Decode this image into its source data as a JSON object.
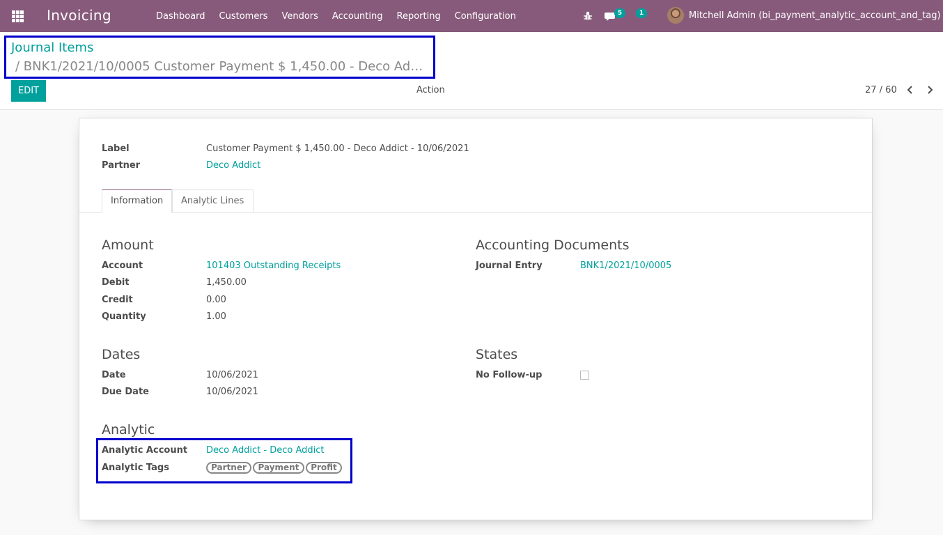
{
  "navbar": {
    "app_name": "Invoicing",
    "menu": [
      "Dashboard",
      "Customers",
      "Vendors",
      "Accounting",
      "Reporting",
      "Configuration"
    ],
    "messages_count": "5",
    "activities_count": "1",
    "user_name": "Mitchell Admin (bi_payment_analytic_account_and_tag)",
    "bg_color": "#875a7b"
  },
  "control": {
    "breadcrumb_root": "Journal Items",
    "breadcrumb_current": "/ BNK1/2021/10/0005 Customer Payment $ 1,450.00 - Deco Ad…",
    "edit_label": "EDIT",
    "action_label": "Action",
    "pager": "27 / 60"
  },
  "form": {
    "label_label": "Label",
    "label_value": "Customer Payment $ 1,450.00 - Deco Addict - 10/06/2021",
    "partner_label": "Partner",
    "partner_value": "Deco Addict",
    "tabs": [
      "Information",
      "Analytic Lines"
    ],
    "amount": {
      "title": "Amount",
      "account_label": "Account",
      "account_value": "101403 Outstanding Receipts",
      "debit_label": "Debit",
      "debit_value": "1,450.00",
      "credit_label": "Credit",
      "credit_value": "0.00",
      "quantity_label": "Quantity",
      "quantity_value": "1.00"
    },
    "accounting_documents": {
      "title": "Accounting Documents",
      "journal_entry_label": "Journal Entry",
      "journal_entry_value": "BNK1/2021/10/0005"
    },
    "dates": {
      "title": "Dates",
      "date_label": "Date",
      "date_value": "10/06/2021",
      "due_date_label": "Due Date",
      "due_date_value": "10/06/2021"
    },
    "states": {
      "title": "States",
      "no_followup_label": "No Follow-up",
      "no_followup_checked": false
    },
    "analytic": {
      "title": "Analytic",
      "account_label": "Analytic Account",
      "account_value": "Deco Addict - Deco Addict",
      "tags_label": "Analytic Tags",
      "tags": [
        "Partner",
        "Payment",
        "Profit"
      ]
    }
  },
  "colors": {
    "accent": "#00a09d",
    "highlight_box": "#0000cc"
  }
}
